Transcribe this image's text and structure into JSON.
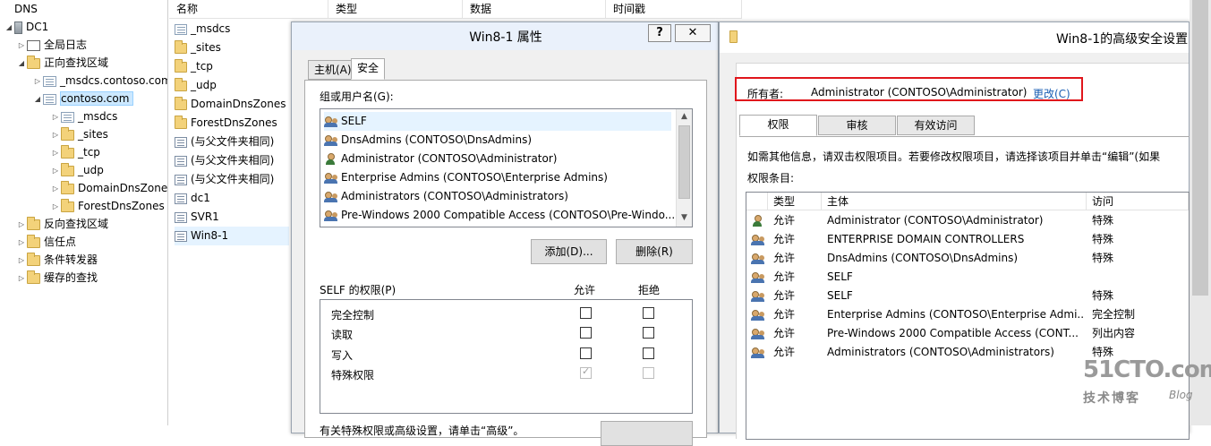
{
  "tree": {
    "root": "DNS",
    "server": "DC1",
    "items": [
      {
        "label": "全局日志"
      },
      {
        "label": "正向查找区域"
      },
      {
        "label": "_msdcs.contoso.com"
      },
      {
        "label": "contoso.com"
      },
      {
        "label": "_msdcs"
      },
      {
        "label": "_sites"
      },
      {
        "label": "_tcp"
      },
      {
        "label": "_udp"
      },
      {
        "label": "DomainDnsZones"
      },
      {
        "label": "ForestDnsZones"
      },
      {
        "label": "反向查找区域"
      },
      {
        "label": "信任点"
      },
      {
        "label": "条件转发器"
      },
      {
        "label": "缓存的查找"
      }
    ]
  },
  "list": {
    "columns": [
      "名称",
      "类型",
      "数据",
      "时间戳"
    ],
    "rows": [
      "_msdcs",
      "_sites",
      "_tcp",
      "_udp",
      "DomainDnsZones",
      "ForestDnsZones",
      "(与父文件夹相同)",
      "(与父文件夹相同)",
      "(与父文件夹相同)",
      "dc1",
      "SVR1",
      "Win8-1"
    ]
  },
  "props": {
    "title": "Win8-1 属性",
    "help": "?",
    "close": "✕",
    "tabs": [
      "主机(A)",
      "安全"
    ],
    "users_label": "组或用户名(G):",
    "users": [
      "SELF",
      "DnsAdmins (CONTOSO\\DnsAdmins)",
      "Administrator (CONTOSO\\Administrator)",
      "Enterprise Admins (CONTOSO\\Enterprise Admins)",
      "Administrators (CONTOSO\\Administrators)",
      "Pre-Windows 2000 Compatible Access (CONTOSO\\Pre-Windo..."
    ],
    "add_button": "添加(D)...",
    "remove_button": "删除(R)",
    "perm_label": "SELF 的权限(P)",
    "allow": "允许",
    "deny": "拒绝",
    "perms": [
      {
        "name": "完全控制",
        "allow": false,
        "deny": false
      },
      {
        "name": "读取",
        "allow": false,
        "deny": false
      },
      {
        "name": "写入",
        "allow": false,
        "deny": false
      },
      {
        "name": "特殊权限",
        "allow": true,
        "deny": false
      }
    ],
    "bottom_text": "有关特殊权限或高级设置，请单击“高级”。"
  },
  "adv": {
    "title": "Win8-1的高级安全设置",
    "owner_label": "所有者:",
    "owner_value": "Administrator (CONTOSO\\Administrator)",
    "change_link": "更改(C)",
    "tabs": [
      "权限",
      "审核",
      "有效访问"
    ],
    "info": "如需其他信息，请双击权限项目。若要修改权限项目，请选择该项目并单击“编辑”(如果",
    "entries_label": "权限条目:",
    "columns": [
      "类型",
      "主体",
      "访问"
    ],
    "entries": [
      {
        "type": "允许",
        "principal": "Administrator (CONTOSO\\Administrator)",
        "access": "特殊",
        "icon": "person"
      },
      {
        "type": "允许",
        "principal": "ENTERPRISE DOMAIN CONTROLLERS",
        "access": "特殊",
        "icon": "group"
      },
      {
        "type": "允许",
        "principal": "DnsAdmins (CONTOSO\\DnsAdmins)",
        "access": "特殊",
        "icon": "group"
      },
      {
        "type": "允许",
        "principal": "SELF",
        "access": "",
        "icon": "group"
      },
      {
        "type": "允许",
        "principal": "SELF",
        "access": "特殊",
        "icon": "group"
      },
      {
        "type": "允许",
        "principal": "Enterprise Admins (CONTOSO\\Enterprise Admi...",
        "access": "完全控制",
        "icon": "group"
      },
      {
        "type": "允许",
        "principal": "Pre-Windows 2000 Compatible Access (CONT...",
        "access": "列出内容",
        "icon": "group"
      },
      {
        "type": "允许",
        "principal": "Administrators (CONTOSO\\Administrators)",
        "access": "特殊",
        "icon": "group"
      }
    ]
  },
  "watermark": {
    "big": "51CTO.com",
    "small": "技术博客",
    "blog": "Blog"
  },
  "colors": {
    "highlight": "#e0161c",
    "link": "#1a5fb4",
    "selection": "#cce8ff"
  }
}
